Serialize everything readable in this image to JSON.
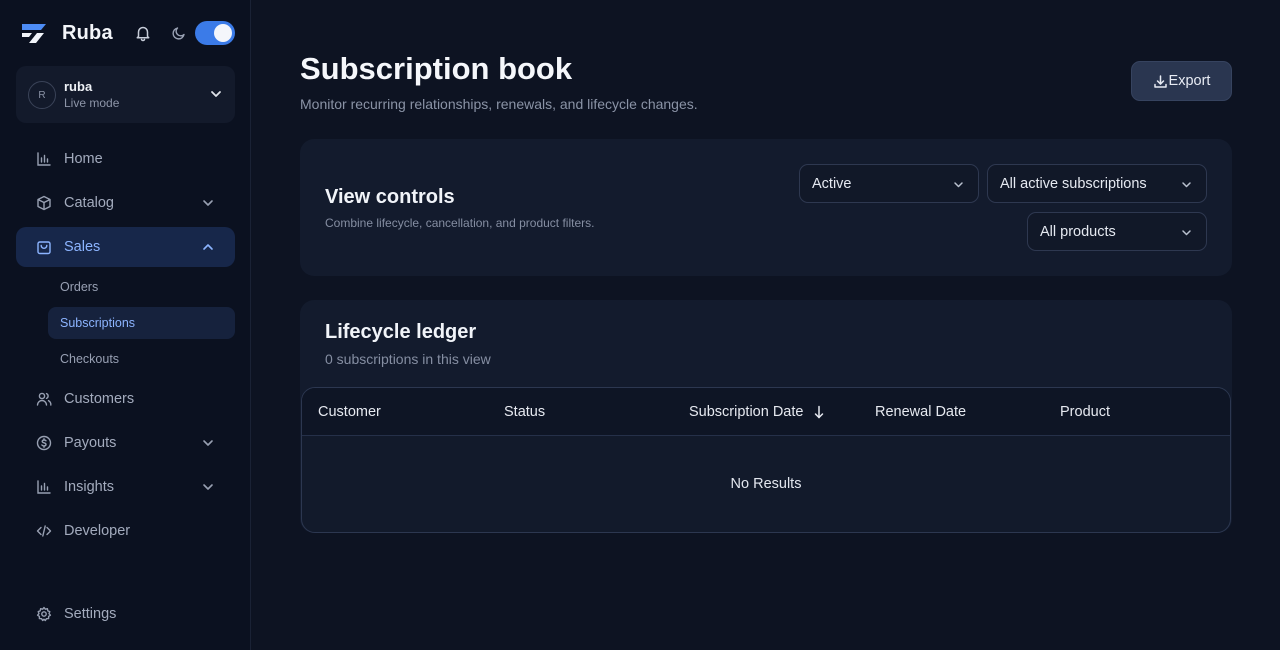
{
  "brand": {
    "name": "Ruba"
  },
  "account": {
    "initial": "R",
    "name": "ruba",
    "mode": "Live mode"
  },
  "nav": {
    "home": "Home",
    "catalog": "Catalog",
    "sales": "Sales",
    "orders": "Orders",
    "subscriptions": "Subscriptions",
    "checkouts": "Checkouts",
    "customers": "Customers",
    "payouts": "Payouts",
    "insights": "Insights",
    "developer": "Developer",
    "settings": "Settings"
  },
  "header": {
    "title": "Subscription book",
    "subtitle": "Monitor recurring relationships, renewals, and lifecycle changes.",
    "export_label": "Export"
  },
  "controls": {
    "title": "View controls",
    "subtitle": "Combine lifecycle, cancellation, and product filters.",
    "lifecycle_value": "Active",
    "cancellation_value": "All active subscriptions",
    "product_value": "All products"
  },
  "ledger": {
    "title": "Lifecycle ledger",
    "count_text": "0 subscriptions in this view",
    "columns": [
      "Customer",
      "Status",
      "Subscription Date",
      "Renewal Date",
      "Product"
    ],
    "empty_text": "No Results"
  },
  "colors": {
    "accent": "#3b7be8",
    "active_text": "#8cb4ff",
    "background": "#0d1322"
  }
}
